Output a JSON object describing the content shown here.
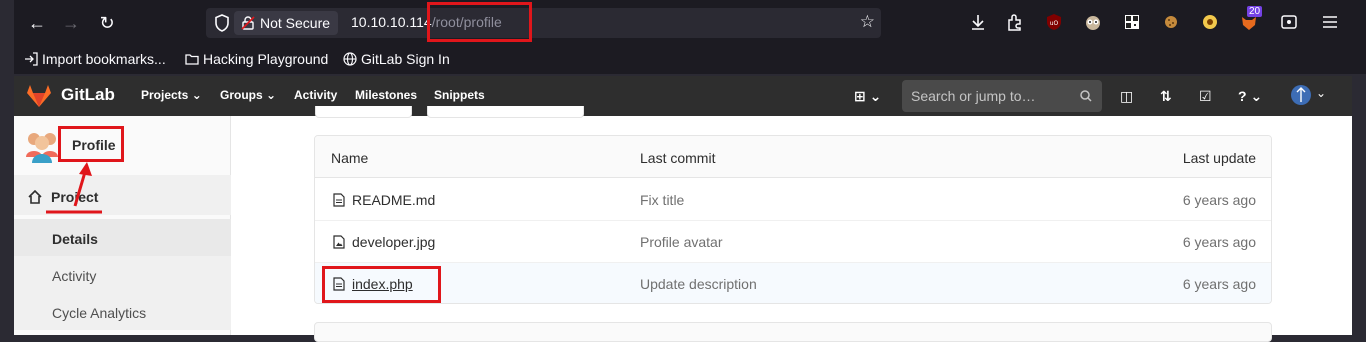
{
  "browser": {
    "security_label": "Not Secure",
    "url_host": "10.10.10.114",
    "url_path": "/root/profile",
    "extension_badge": "20"
  },
  "bookmarks": [
    {
      "label": "Import bookmarks...",
      "icon": "import-icon"
    },
    {
      "label": "Hacking Playground",
      "icon": "folder-icon"
    },
    {
      "label": "GitLab Sign In",
      "icon": "globe-icon"
    }
  ],
  "gitlab": {
    "brand": "GitLab",
    "nav": [
      "Projects",
      "Groups",
      "Activity",
      "Milestones",
      "Snippets"
    ],
    "search_placeholder": "Search or jump to…"
  },
  "sidebar": {
    "title": "Profile",
    "section": "Project",
    "items": [
      "Details",
      "Activity",
      "Cycle Analytics"
    ]
  },
  "file_tree": {
    "headers": {
      "name": "Name",
      "last_commit": "Last commit",
      "last_update": "Last update"
    },
    "rows": [
      {
        "name": "README.md",
        "commit": "Fix title",
        "updated": "6 years ago",
        "icon": "file-text-icon"
      },
      {
        "name": "developer.jpg",
        "commit": "Profile avatar",
        "updated": "6 years ago",
        "icon": "file-image-icon"
      },
      {
        "name": "index.php",
        "commit": "Update description",
        "updated": "6 years ago",
        "icon": "file-text-icon"
      }
    ]
  },
  "colors": {
    "gitlab_header": "#2e2e2e",
    "annotation": "#e0161b",
    "browser_chrome": "#1c1b22"
  }
}
